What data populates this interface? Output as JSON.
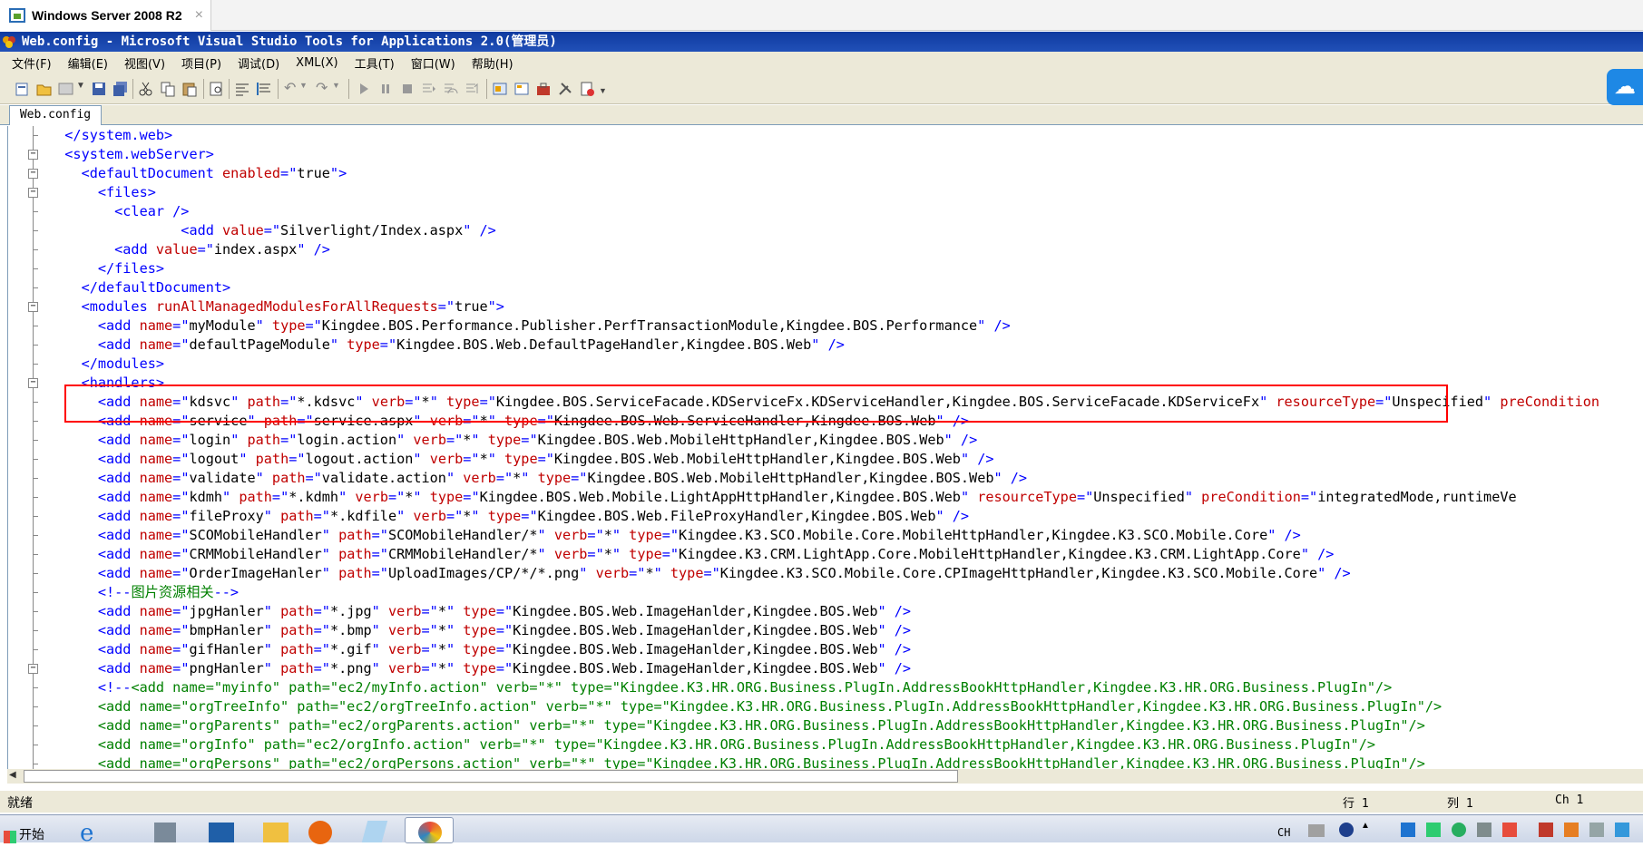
{
  "vm_tab": {
    "title": "Windows Server 2008 R2",
    "close": "×"
  },
  "window": {
    "title": "Web.config - Microsoft Visual Studio Tools for Applications 2.0(管理员)"
  },
  "menu": [
    "文件(F)",
    "编辑(E)",
    "视图(V)",
    "项目(P)",
    "调试(D)",
    "XML(X)",
    "工具(T)",
    "窗口(W)",
    "帮助(H)"
  ],
  "doc_tab": "Web.config",
  "code_lines": [
    [
      [
        "b",
        "  </system.web>"
      ]
    ],
    [
      [
        "b",
        "  <system.webServer>"
      ]
    ],
    [
      [
        "b",
        "    <defaultDocument "
      ],
      [
        "r",
        "enabled"
      ],
      [
        "b",
        "=\""
      ],
      [
        "k",
        "true"
      ],
      [
        "b",
        "\">"
      ]
    ],
    [
      [
        "b",
        "      <files>"
      ]
    ],
    [
      [
        "b",
        "        <clear />"
      ]
    ],
    [
      [
        "b",
        "                <add "
      ],
      [
        "r",
        "value"
      ],
      [
        "b",
        "=\""
      ],
      [
        "k",
        "Silverlight/Index.aspx"
      ],
      [
        "b",
        "\" />"
      ]
    ],
    [
      [
        "b",
        "        <add "
      ],
      [
        "r",
        "value"
      ],
      [
        "b",
        "=\""
      ],
      [
        "k",
        "index.aspx"
      ],
      [
        "b",
        "\" />"
      ]
    ],
    [
      [
        "b",
        "      </files>"
      ]
    ],
    [
      [
        "b",
        "    </defaultDocument>"
      ]
    ],
    [
      [
        "b",
        "    <modules "
      ],
      [
        "r",
        "runAllManagedModulesForAllRequests"
      ],
      [
        "b",
        "=\""
      ],
      [
        "k",
        "true"
      ],
      [
        "b",
        "\">"
      ]
    ],
    [
      [
        "b",
        "      <add "
      ],
      [
        "r",
        "name"
      ],
      [
        "b",
        "=\""
      ],
      [
        "k",
        "myModule"
      ],
      [
        "b",
        "\" "
      ],
      [
        "r",
        "type"
      ],
      [
        "b",
        "=\""
      ],
      [
        "k",
        "Kingdee.BOS.Performance.Publisher.PerfTransactionModule,Kingdee.BOS.Performance"
      ],
      [
        "b",
        "\" />"
      ]
    ],
    [
      [
        "b",
        "      <add "
      ],
      [
        "r",
        "name"
      ],
      [
        "b",
        "=\""
      ],
      [
        "k",
        "defaultPageModule"
      ],
      [
        "b",
        "\" "
      ],
      [
        "r",
        "type"
      ],
      [
        "b",
        "=\""
      ],
      [
        "k",
        "Kingdee.BOS.Web.DefaultPageHandler,Kingdee.BOS.Web"
      ],
      [
        "b",
        "\" />"
      ]
    ],
    [
      [
        "b",
        "    </modules>"
      ]
    ],
    [
      [
        "b",
        "    <handlers>"
      ]
    ],
    [
      [
        "b",
        "      <add "
      ],
      [
        "r",
        "name"
      ],
      [
        "b",
        "=\""
      ],
      [
        "k",
        "kdsvc"
      ],
      [
        "b",
        "\" "
      ],
      [
        "r",
        "path"
      ],
      [
        "b",
        "=\""
      ],
      [
        "k",
        "*.kdsvc"
      ],
      [
        "b",
        "\" "
      ],
      [
        "r",
        "verb"
      ],
      [
        "b",
        "=\""
      ],
      [
        "k",
        "*"
      ],
      [
        "b",
        "\" "
      ],
      [
        "r",
        "type"
      ],
      [
        "b",
        "=\""
      ],
      [
        "k",
        "Kingdee.BOS.ServiceFacade.KDServiceFx.KDServiceHandler,Kingdee.BOS.ServiceFacade.KDServiceFx"
      ],
      [
        "b",
        "\" "
      ],
      [
        "r",
        "resourceType"
      ],
      [
        "b",
        "=\""
      ],
      [
        "k",
        "Unspecified"
      ],
      [
        "b",
        "\" "
      ],
      [
        "r",
        "preCondition"
      ]
    ],
    [
      [
        "b",
        "      <add "
      ],
      [
        "r",
        "name"
      ],
      [
        "b",
        "=\""
      ],
      [
        "k",
        "service"
      ],
      [
        "b",
        "\" "
      ],
      [
        "r",
        "path"
      ],
      [
        "b",
        "=\""
      ],
      [
        "k",
        "service.aspx"
      ],
      [
        "b",
        "\" "
      ],
      [
        "r",
        "verb"
      ],
      [
        "b",
        "=\""
      ],
      [
        "k",
        "*"
      ],
      [
        "b",
        "\" "
      ],
      [
        "r",
        "type"
      ],
      [
        "b",
        "=\""
      ],
      [
        "k",
        "Kingdee.BOS.Web.ServiceHandler,Kingdee.BOS.Web"
      ],
      [
        "b",
        "\" />"
      ]
    ],
    [
      [
        "b",
        "      <add "
      ],
      [
        "r",
        "name"
      ],
      [
        "b",
        "=\""
      ],
      [
        "k",
        "login"
      ],
      [
        "b",
        "\" "
      ],
      [
        "r",
        "path"
      ],
      [
        "b",
        "=\""
      ],
      [
        "k",
        "login.action"
      ],
      [
        "b",
        "\" "
      ],
      [
        "r",
        "verb"
      ],
      [
        "b",
        "=\""
      ],
      [
        "k",
        "*"
      ],
      [
        "b",
        "\" "
      ],
      [
        "r",
        "type"
      ],
      [
        "b",
        "=\""
      ],
      [
        "k",
        "Kingdee.BOS.Web.MobileHttpHandler,Kingdee.BOS.Web"
      ],
      [
        "b",
        "\" />"
      ]
    ],
    [
      [
        "b",
        "      <add "
      ],
      [
        "r",
        "name"
      ],
      [
        "b",
        "=\""
      ],
      [
        "k",
        "logout"
      ],
      [
        "b",
        "\" "
      ],
      [
        "r",
        "path"
      ],
      [
        "b",
        "=\""
      ],
      [
        "k",
        "logout.action"
      ],
      [
        "b",
        "\" "
      ],
      [
        "r",
        "verb"
      ],
      [
        "b",
        "=\""
      ],
      [
        "k",
        "*"
      ],
      [
        "b",
        "\" "
      ],
      [
        "r",
        "type"
      ],
      [
        "b",
        "=\""
      ],
      [
        "k",
        "Kingdee.BOS.Web.MobileHttpHandler,Kingdee.BOS.Web"
      ],
      [
        "b",
        "\" />"
      ]
    ],
    [
      [
        "b",
        "      <add "
      ],
      [
        "r",
        "name"
      ],
      [
        "b",
        "=\""
      ],
      [
        "k",
        "validate"
      ],
      [
        "b",
        "\" "
      ],
      [
        "r",
        "path"
      ],
      [
        "b",
        "=\""
      ],
      [
        "k",
        "validate.action"
      ],
      [
        "b",
        "\" "
      ],
      [
        "r",
        "verb"
      ],
      [
        "b",
        "=\""
      ],
      [
        "k",
        "*"
      ],
      [
        "b",
        "\" "
      ],
      [
        "r",
        "type"
      ],
      [
        "b",
        "=\""
      ],
      [
        "k",
        "Kingdee.BOS.Web.MobileHttpHandler,Kingdee.BOS.Web"
      ],
      [
        "b",
        "\" />"
      ]
    ],
    [
      [
        "b",
        "      <add "
      ],
      [
        "r",
        "name"
      ],
      [
        "b",
        "=\""
      ],
      [
        "k",
        "kdmh"
      ],
      [
        "b",
        "\" "
      ],
      [
        "r",
        "path"
      ],
      [
        "b",
        "=\""
      ],
      [
        "k",
        "*.kdmh"
      ],
      [
        "b",
        "\" "
      ],
      [
        "r",
        "verb"
      ],
      [
        "b",
        "=\""
      ],
      [
        "k",
        "*"
      ],
      [
        "b",
        "\" "
      ],
      [
        "r",
        "type"
      ],
      [
        "b",
        "=\""
      ],
      [
        "k",
        "Kingdee.BOS.Web.Mobile.LightAppHttpHandler,Kingdee.BOS.Web"
      ],
      [
        "b",
        "\" "
      ],
      [
        "r",
        "resourceType"
      ],
      [
        "b",
        "=\""
      ],
      [
        "k",
        "Unspecified"
      ],
      [
        "b",
        "\" "
      ],
      [
        "r",
        "preCondition"
      ],
      [
        "b",
        "=\""
      ],
      [
        "k",
        "integratedMode,runtimeVe"
      ]
    ],
    [
      [
        "b",
        "      <add "
      ],
      [
        "r",
        "name"
      ],
      [
        "b",
        "=\""
      ],
      [
        "k",
        "fileProxy"
      ],
      [
        "b",
        "\" "
      ],
      [
        "r",
        "path"
      ],
      [
        "b",
        "=\""
      ],
      [
        "k",
        "*.kdfile"
      ],
      [
        "b",
        "\" "
      ],
      [
        "r",
        "verb"
      ],
      [
        "b",
        "=\""
      ],
      [
        "k",
        "*"
      ],
      [
        "b",
        "\" "
      ],
      [
        "r",
        "type"
      ],
      [
        "b",
        "=\""
      ],
      [
        "k",
        "Kingdee.BOS.Web.FileProxyHandler,Kingdee.BOS.Web"
      ],
      [
        "b",
        "\" />"
      ]
    ],
    [
      [
        "b",
        "      <add "
      ],
      [
        "r",
        "name"
      ],
      [
        "b",
        "=\""
      ],
      [
        "k",
        "SCOMobileHandler"
      ],
      [
        "b",
        "\" "
      ],
      [
        "r",
        "path"
      ],
      [
        "b",
        "=\""
      ],
      [
        "k",
        "SCOMobileHandler/*"
      ],
      [
        "b",
        "\" "
      ],
      [
        "r",
        "verb"
      ],
      [
        "b",
        "=\""
      ],
      [
        "k",
        "*"
      ],
      [
        "b",
        "\" "
      ],
      [
        "r",
        "type"
      ],
      [
        "b",
        "=\""
      ],
      [
        "k",
        "Kingdee.K3.SCO.Mobile.Core.MobileHttpHandler,Kingdee.K3.SCO.Mobile.Core"
      ],
      [
        "b",
        "\" />"
      ]
    ],
    [
      [
        "b",
        "      <add "
      ],
      [
        "r",
        "name"
      ],
      [
        "b",
        "=\""
      ],
      [
        "k",
        "CRMMobileHandler"
      ],
      [
        "b",
        "\" "
      ],
      [
        "r",
        "path"
      ],
      [
        "b",
        "=\""
      ],
      [
        "k",
        "CRMMobileHandler/*"
      ],
      [
        "b",
        "\" "
      ],
      [
        "r",
        "verb"
      ],
      [
        "b",
        "=\""
      ],
      [
        "k",
        "*"
      ],
      [
        "b",
        "\" "
      ],
      [
        "r",
        "type"
      ],
      [
        "b",
        "=\""
      ],
      [
        "k",
        "Kingdee.K3.CRM.LightApp.Core.MobileHttpHandler,Kingdee.K3.CRM.LightApp.Core"
      ],
      [
        "b",
        "\" />"
      ]
    ],
    [
      [
        "b",
        "      <add "
      ],
      [
        "r",
        "name"
      ],
      [
        "b",
        "=\""
      ],
      [
        "k",
        "OrderImageHanler"
      ],
      [
        "b",
        "\" "
      ],
      [
        "r",
        "path"
      ],
      [
        "b",
        "=\""
      ],
      [
        "k",
        "UploadImages/CP/*/*.png"
      ],
      [
        "b",
        "\" "
      ],
      [
        "r",
        "verb"
      ],
      [
        "b",
        "=\""
      ],
      [
        "k",
        "*"
      ],
      [
        "b",
        "\" "
      ],
      [
        "r",
        "type"
      ],
      [
        "b",
        "=\""
      ],
      [
        "k",
        "Kingdee.K3.SCO.Mobile.Core.CPImageHttpHandler,Kingdee.K3.SCO.Mobile.Core"
      ],
      [
        "b",
        "\" />"
      ]
    ],
    [
      [
        "b",
        "      <!--"
      ],
      [
        "g",
        "图片资源相关"
      ],
      [
        "b",
        "-->"
      ]
    ],
    [
      [
        "b",
        "      <add "
      ],
      [
        "r",
        "name"
      ],
      [
        "b",
        "=\""
      ],
      [
        "k",
        "jpgHanler"
      ],
      [
        "b",
        "\" "
      ],
      [
        "r",
        "path"
      ],
      [
        "b",
        "=\""
      ],
      [
        "k",
        "*.jpg"
      ],
      [
        "b",
        "\" "
      ],
      [
        "r",
        "verb"
      ],
      [
        "b",
        "=\""
      ],
      [
        "k",
        "*"
      ],
      [
        "b",
        "\" "
      ],
      [
        "r",
        "type"
      ],
      [
        "b",
        "=\""
      ],
      [
        "k",
        "Kingdee.BOS.Web.ImageHanlder,Kingdee.BOS.Web"
      ],
      [
        "b",
        "\" />"
      ]
    ],
    [
      [
        "b",
        "      <add "
      ],
      [
        "r",
        "name"
      ],
      [
        "b",
        "=\""
      ],
      [
        "k",
        "bmpHanler"
      ],
      [
        "b",
        "\" "
      ],
      [
        "r",
        "path"
      ],
      [
        "b",
        "=\""
      ],
      [
        "k",
        "*.bmp"
      ],
      [
        "b",
        "\" "
      ],
      [
        "r",
        "verb"
      ],
      [
        "b",
        "=\""
      ],
      [
        "k",
        "*"
      ],
      [
        "b",
        "\" "
      ],
      [
        "r",
        "type"
      ],
      [
        "b",
        "=\""
      ],
      [
        "k",
        "Kingdee.BOS.Web.ImageHanlder,Kingdee.BOS.Web"
      ],
      [
        "b",
        "\" />"
      ]
    ],
    [
      [
        "b",
        "      <add "
      ],
      [
        "r",
        "name"
      ],
      [
        "b",
        "=\""
      ],
      [
        "k",
        "gifHanler"
      ],
      [
        "b",
        "\" "
      ],
      [
        "r",
        "path"
      ],
      [
        "b",
        "=\""
      ],
      [
        "k",
        "*.gif"
      ],
      [
        "b",
        "\" "
      ],
      [
        "r",
        "verb"
      ],
      [
        "b",
        "=\""
      ],
      [
        "k",
        "*"
      ],
      [
        "b",
        "\" "
      ],
      [
        "r",
        "type"
      ],
      [
        "b",
        "=\""
      ],
      [
        "k",
        "Kingdee.BOS.Web.ImageHanlder,Kingdee.BOS.Web"
      ],
      [
        "b",
        "\" />"
      ]
    ],
    [
      [
        "b",
        "      <add "
      ],
      [
        "r",
        "name"
      ],
      [
        "b",
        "=\""
      ],
      [
        "k",
        "pngHanler"
      ],
      [
        "b",
        "\" "
      ],
      [
        "r",
        "path"
      ],
      [
        "b",
        "=\""
      ],
      [
        "k",
        "*.png"
      ],
      [
        "b",
        "\" "
      ],
      [
        "r",
        "verb"
      ],
      [
        "b",
        "=\""
      ],
      [
        "k",
        "*"
      ],
      [
        "b",
        "\" "
      ],
      [
        "r",
        "type"
      ],
      [
        "b",
        "=\""
      ],
      [
        "k",
        "Kingdee.BOS.Web.ImageHanlder,Kingdee.BOS.Web"
      ],
      [
        "b",
        "\" />"
      ]
    ],
    [
      [
        "b",
        "      <!--"
      ],
      [
        "g",
        "<add name=\"myinfo\" path=\"ec2/myInfo.action\" verb=\"*\" type=\"Kingdee.K3.HR.ORG.Business.PlugIn.AddressBookHttpHandler,Kingdee.K3.HR.ORG.Business.PlugIn\"/>"
      ]
    ],
    [
      [
        "g",
        "      <add name=\"orgTreeInfo\" path=\"ec2/orgTreeInfo.action\" verb=\"*\" type=\"Kingdee.K3.HR.ORG.Business.PlugIn.AddressBookHttpHandler,Kingdee.K3.HR.ORG.Business.PlugIn\"/>"
      ]
    ],
    [
      [
        "g",
        "      <add name=\"orgParents\" path=\"ec2/orgParents.action\" verb=\"*\" type=\"Kingdee.K3.HR.ORG.Business.PlugIn.AddressBookHttpHandler,Kingdee.K3.HR.ORG.Business.PlugIn\"/>"
      ]
    ],
    [
      [
        "g",
        "      <add name=\"orgInfo\" path=\"ec2/orgInfo.action\" verb=\"*\" type=\"Kingdee.K3.HR.ORG.Business.PlugIn.AddressBookHttpHandler,Kingdee.K3.HR.ORG.Business.PlugIn\"/>"
      ]
    ],
    [
      [
        "g",
        "      <add name=\"orgPersons\" path=\"ec2/orgPersons.action\" verb=\"*\" type=\"Kingdee.K3.HR.ORG.Business.PlugIn.AddressBookHttpHandler,Kingdee.K3.HR.ORG.Business.PlugIn\"/>"
      ]
    ]
  ],
  "status": {
    "ready": "就绪",
    "line": "行 1",
    "col": "列 1",
    "ch": "Ch 1"
  },
  "taskbar": {
    "start": "开始",
    "ime": "CH"
  },
  "colors": {
    "titlebar": "#1a46ad",
    "chrome": "#ece9d8",
    "tag": "#0000ff",
    "attr": "#c00000",
    "comment": "#008000",
    "highlight_box": "#ff0000"
  }
}
